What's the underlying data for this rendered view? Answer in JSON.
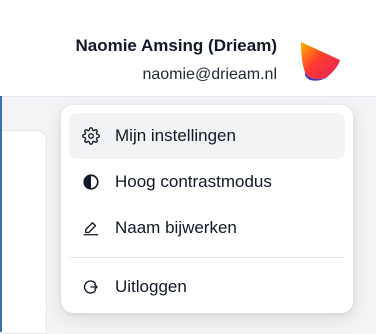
{
  "user": {
    "name": "Naomie Amsing (Drieam)",
    "email": "naomie@drieam.nl",
    "avatar_icon": "drieam-logo-icon"
  },
  "menu": {
    "items": [
      {
        "label": "Mijn instellingen",
        "icon": "gear-icon"
      },
      {
        "label": "Hoog contrastmodus",
        "icon": "contrast-icon"
      },
      {
        "label": "Naam bijwerken",
        "icon": "pencil-icon"
      }
    ],
    "logout": {
      "label": "Uitloggen",
      "icon": "logout-icon"
    }
  },
  "colors": {
    "accent_blue": "#3b6fae",
    "menu_hover": "#f1f3f5"
  }
}
